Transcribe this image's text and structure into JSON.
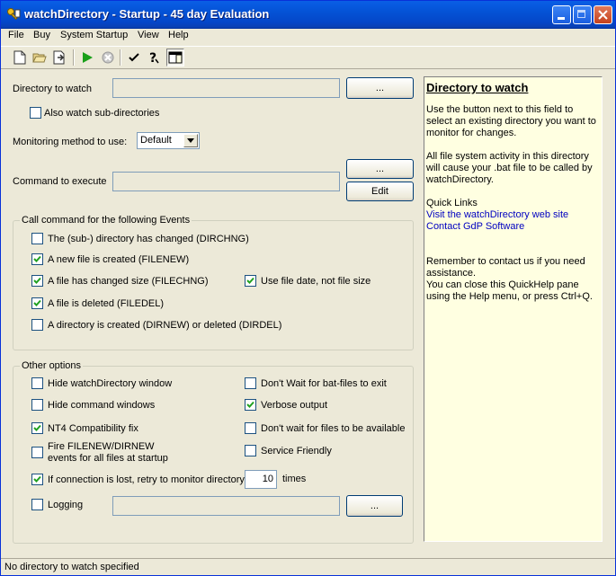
{
  "window": {
    "title": "watchDirectory - Startup - 45 day Evaluation"
  },
  "menu": [
    "File",
    "Buy",
    "System Startup",
    "View",
    "Help"
  ],
  "main": {
    "directory_label": "Directory to watch",
    "directory_value": "",
    "browse_label": "...",
    "subdirs_label": "Also watch sub-directories",
    "subdirs_checked": false,
    "method_label": "Monitoring method to use:",
    "method_value": "Default",
    "command_label": "Command to execute",
    "command_value": "",
    "command_browse_label": "...",
    "edit_label": "Edit"
  },
  "events": {
    "title": "Call command for the following Events",
    "items": [
      {
        "label": "The (sub-) directory has changed (DIRCHNG)",
        "checked": false
      },
      {
        "label": "A new file is created (FILENEW)",
        "checked": true
      },
      {
        "label": "A file has changed size (FILECHNG)",
        "checked": true
      },
      {
        "label": "A file is deleted (FILEDEL)",
        "checked": true
      },
      {
        "label": "A directory is created (DIRNEW) or deleted (DIRDEL)",
        "checked": false
      }
    ],
    "use_date": {
      "label": "Use file date, not file size",
      "checked": true
    }
  },
  "options": {
    "title": "Other options",
    "hide_window": {
      "label": "Hide watchDirectory window",
      "checked": false
    },
    "hide_cmd": {
      "label": "Hide command windows",
      "checked": false
    },
    "nt4": {
      "label": "NT4 Compatibility fix",
      "checked": true
    },
    "fire_events": {
      "label_line1": "Fire FILENEW/DIRNEW",
      "label_line2": "events for all files at startup",
      "checked": false
    },
    "retry": {
      "label": "If connection is lost, retry to monitor directory",
      "checked": true,
      "times_value": "10",
      "times_label": "times"
    },
    "logging": {
      "label": "Logging",
      "checked": false,
      "value": "",
      "browse_label": "..."
    },
    "dont_wait_bat": {
      "label": "Don't Wait for bat-files to exit",
      "checked": false
    },
    "verbose": {
      "label": "Verbose output",
      "checked": true
    },
    "dont_wait_files": {
      "label": "Don't wait for files to be available",
      "checked": false
    },
    "service": {
      "label": "Service Friendly",
      "checked": false
    }
  },
  "help": {
    "title": "Directory to watch",
    "para1": "Use the button next to this field to select an existing directory you want to monitor for changes.",
    "para2": "All file system activity in this directory will cause your .bat file to be called by watchDirectory.",
    "quick_links_label": "Quick Links",
    "link1": "Visit the watchDirectory web site",
    "link2": "Contact GdP Software",
    "para3": "Remember to contact us if you need assistance.",
    "para4": "You can close this QuickHelp pane using the Help menu, or press Ctrl+Q."
  },
  "status": {
    "text": "No directory to watch specified"
  }
}
